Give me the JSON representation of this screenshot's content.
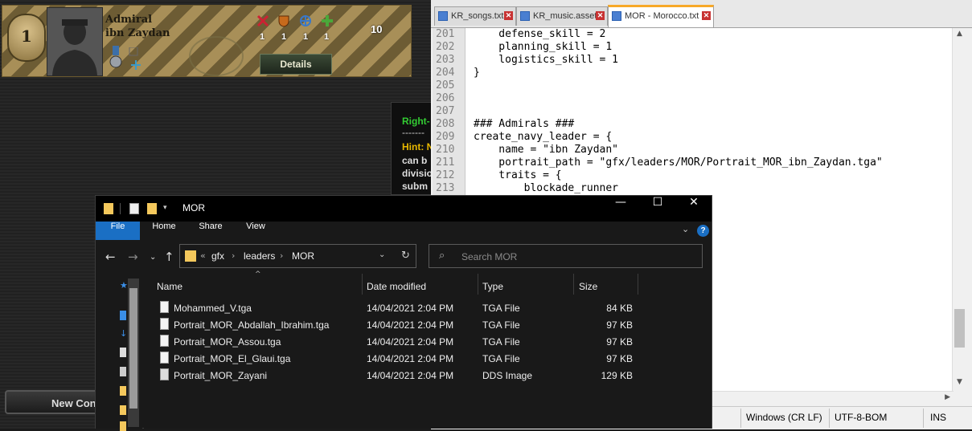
{
  "game": {
    "leader": {
      "rank_number": "1",
      "rank_title": "Admiral",
      "name": "ibn Zaydan",
      "skills": [
        "1",
        "1",
        "1",
        "1"
      ],
      "count": "10",
      "details_label": "Details"
    },
    "tooltip": {
      "line1": "Right-",
      "line2": "-------",
      "hint_label": "Hint: N",
      "body_lines": [
        "can b",
        "divisio",
        "subm"
      ]
    },
    "new_combat_label": "New Con"
  },
  "notepad": {
    "tabs": [
      {
        "label": "KR_songs.txt"
      },
      {
        "label": "KR_music.asset"
      },
      {
        "label": "MOR - Morocco.txt"
      }
    ],
    "lines": [
      {
        "num": "201",
        "text": "    defense_skill = 2"
      },
      {
        "num": "202",
        "text": "    planning_skill = 1"
      },
      {
        "num": "203",
        "text": "    logistics_skill = 1"
      },
      {
        "num": "204",
        "text": "}"
      },
      {
        "num": "205",
        "text": ""
      },
      {
        "num": "206",
        "text": ""
      },
      {
        "num": "207",
        "text": ""
      },
      {
        "num": "208",
        "text": "### Admirals ###"
      },
      {
        "num": "209",
        "text": "create_navy_leader = {"
      },
      {
        "num": "210",
        "text": "    name = \"ibn Zaydan\""
      },
      {
        "num": "211",
        "text": "    portrait_path = \"gfx/leaders/MOR/Portrait_MOR_ibn_Zaydan.tga\""
      },
      {
        "num": "212",
        "text": "    traits = {"
      },
      {
        "num": "213",
        "text": "        blockade_runner"
      }
    ],
    "status": {
      "eol": "Windows (CR LF)",
      "encoding": "UTF-8-BOM",
      "mode": "INS"
    }
  },
  "explorer": {
    "title": "MOR",
    "ribbon": [
      "File",
      "Home",
      "Share",
      "View"
    ],
    "breadcrumb": [
      "gfx",
      "leaders",
      "MOR"
    ],
    "breadcrumb_prefix": "«",
    "search_placeholder": "Search MOR",
    "columns": {
      "name": "Name",
      "date": "Date modified",
      "type": "Type",
      "size": "Size"
    },
    "files": [
      {
        "name": "Mohammed_V.tga",
        "date": "14/04/2021 2:04 PM",
        "type": "TGA File",
        "size": "84 KB"
      },
      {
        "name": "Portrait_MOR_Abdallah_Ibrahim.tga",
        "date": "14/04/2021 2:04 PM",
        "type": "TGA File",
        "size": "97 KB"
      },
      {
        "name": "Portrait_MOR_Assou.tga",
        "date": "14/04/2021 2:04 PM",
        "type": "TGA File",
        "size": "97 KB"
      },
      {
        "name": "Portrait_MOR_El_Glaui.tga",
        "date": "14/04/2021 2:04 PM",
        "type": "TGA File",
        "size": "97 KB"
      },
      {
        "name": "Portrait_MOR_Zayani",
        "date": "14/04/2021 2:04 PM",
        "type": "DDS Image",
        "size": "129 KB"
      }
    ]
  }
}
